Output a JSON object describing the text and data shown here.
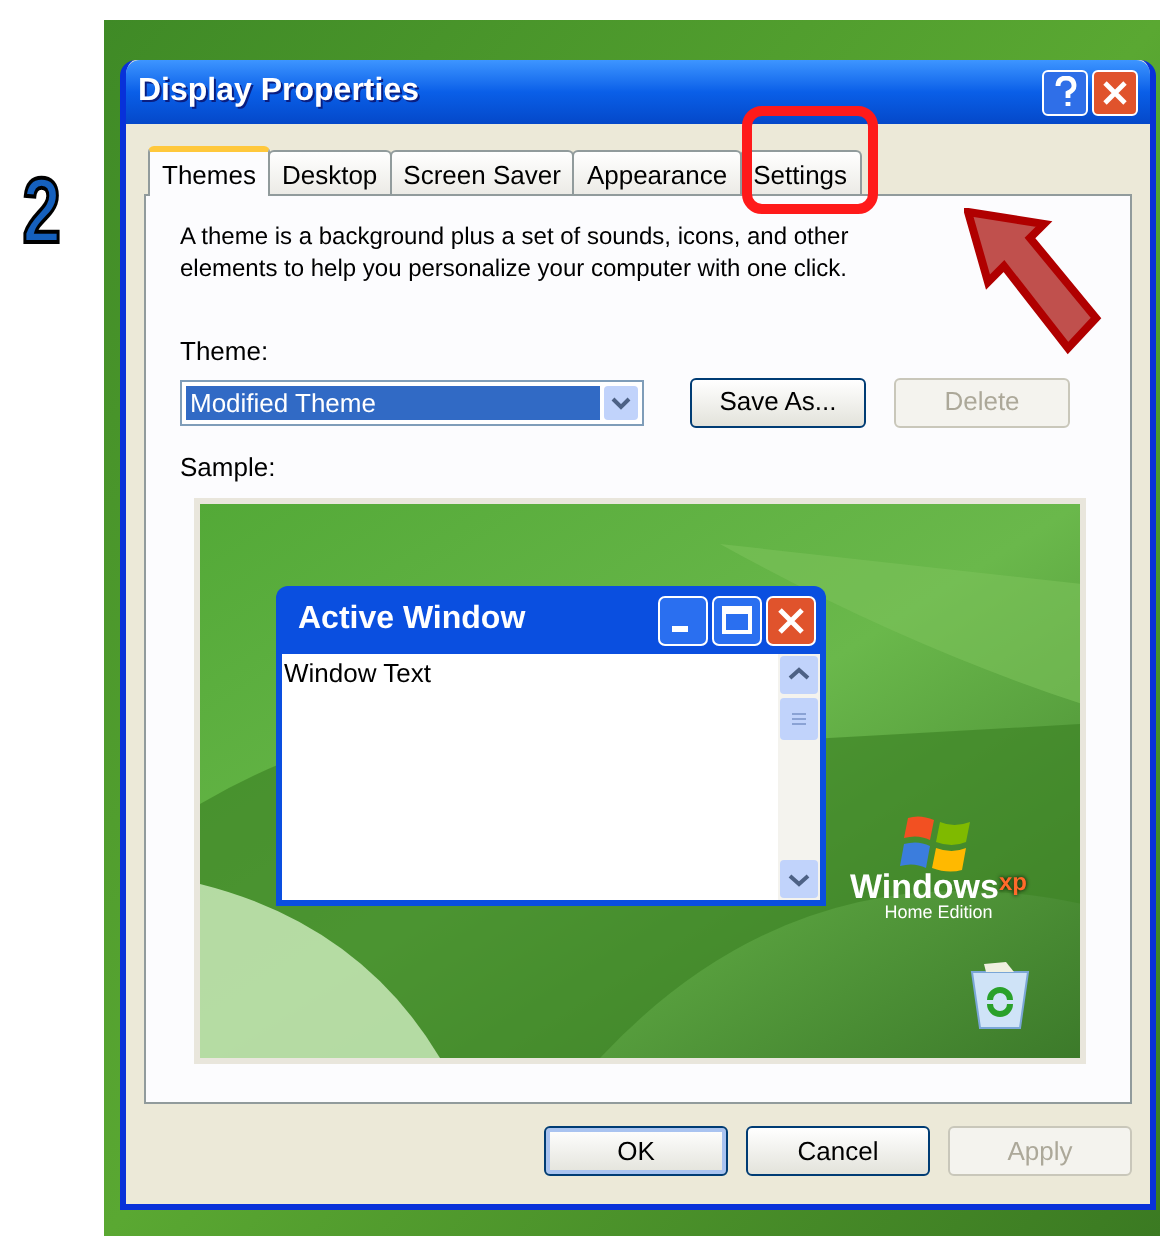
{
  "annotation": {
    "step": "2"
  },
  "window": {
    "title": "Display Properties"
  },
  "tabs": [
    {
      "label": "Themes",
      "selected": true,
      "highlighted": false
    },
    {
      "label": "Desktop",
      "selected": false,
      "highlighted": false
    },
    {
      "label": "Screen Saver",
      "selected": false,
      "highlighted": false
    },
    {
      "label": "Appearance",
      "selected": false,
      "highlighted": false
    },
    {
      "label": "Settings",
      "selected": false,
      "highlighted": true
    }
  ],
  "description": "A theme is a background plus a set of sounds, icons, and other elements to help you personalize your computer with one click.",
  "theme": {
    "label": "Theme:",
    "value": "Modified Theme",
    "buttons": [
      {
        "label": "Save As...",
        "disabled": false
      },
      {
        "label": "Delete",
        "disabled": true
      }
    ]
  },
  "sample": {
    "label": "Sample:",
    "window_title": "Active Window",
    "window_text": "Window Text",
    "logo": {
      "name": "Windows",
      "suffix": "xp",
      "edition": "Home Edition"
    }
  },
  "buttons": [
    {
      "label": "OK",
      "disabled": false,
      "default": true
    },
    {
      "label": "Cancel",
      "disabled": false,
      "default": false
    },
    {
      "label": "Apply",
      "disabled": true,
      "default": false
    }
  ]
}
